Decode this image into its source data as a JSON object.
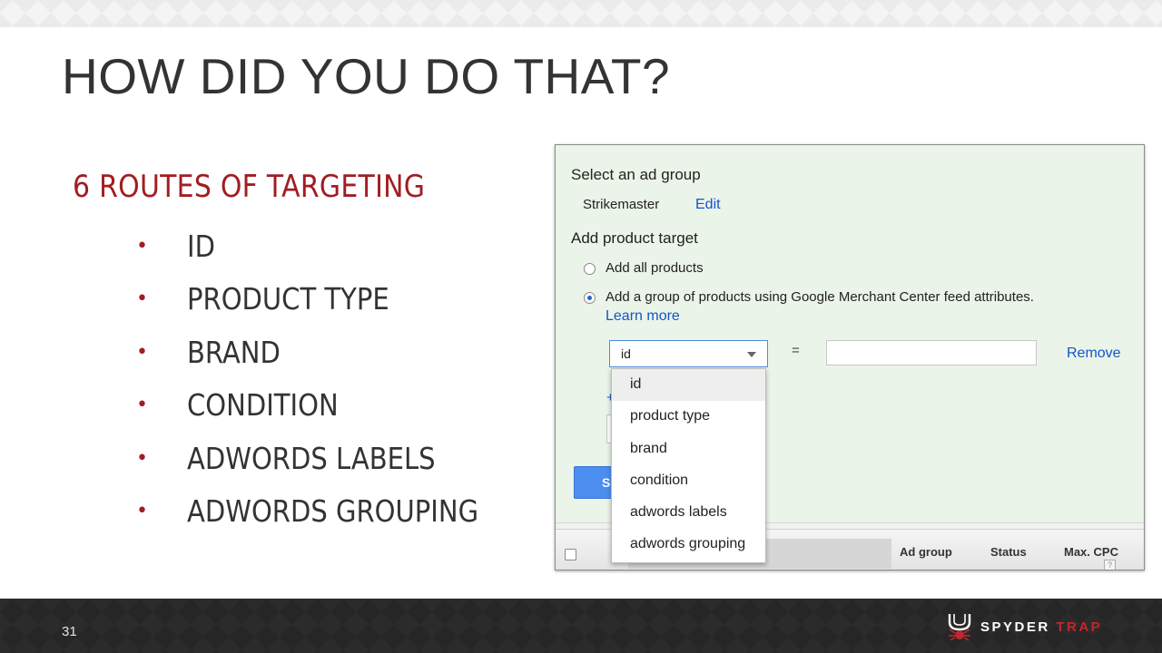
{
  "slide": {
    "title": "HOW DID YOU DO THAT?",
    "section_heading": "6 ROUTES OF TARGETING",
    "bullets": [
      "ID",
      "PRODUCT TYPE",
      "BRAND",
      "CONDITION",
      "ADWORDS LABELS",
      "ADWORDS GROUPING"
    ],
    "page_number": "31"
  },
  "panel": {
    "select_ad_group_label": "Select an ad group",
    "ad_group_name": "Strikemaster",
    "edit_link": "Edit",
    "add_product_target_label": "Add product target",
    "radio_all_products": "Add all products",
    "radio_all_products_selected": false,
    "radio_group_products": "Add a group of products using Google Merchant Center feed attributes.",
    "radio_group_products_selected": true,
    "learn_more_link": "Learn more",
    "attribute_select_value": "id",
    "equals_sign": "=",
    "value_input": "",
    "remove_link": "Remove",
    "plus_link": "+",
    "blue_button_visible_text": "S",
    "dropdown_options": [
      "id",
      "product type",
      "brand",
      "condition",
      "adwords labels",
      "adwords grouping"
    ],
    "dropdown_highlighted": "id",
    "table_columns": [
      "Ad group",
      "Status",
      "Max. CPC"
    ],
    "help_icon_text": "?"
  },
  "footer": {
    "brand_primary": "SPYDER",
    "brand_accent": "TRAP"
  },
  "colors": {
    "accent_red": "#a11d22",
    "panel_bg": "#ebf4e8",
    "link_blue": "#1155cc",
    "button_blue": "#4b8ef0",
    "footer_bg": "#262626"
  },
  "icons": [
    "bullet-dot-icon",
    "radio-icon",
    "chevron-down-icon",
    "checkbox-icon",
    "help-icon",
    "spider-logo-icon"
  ]
}
